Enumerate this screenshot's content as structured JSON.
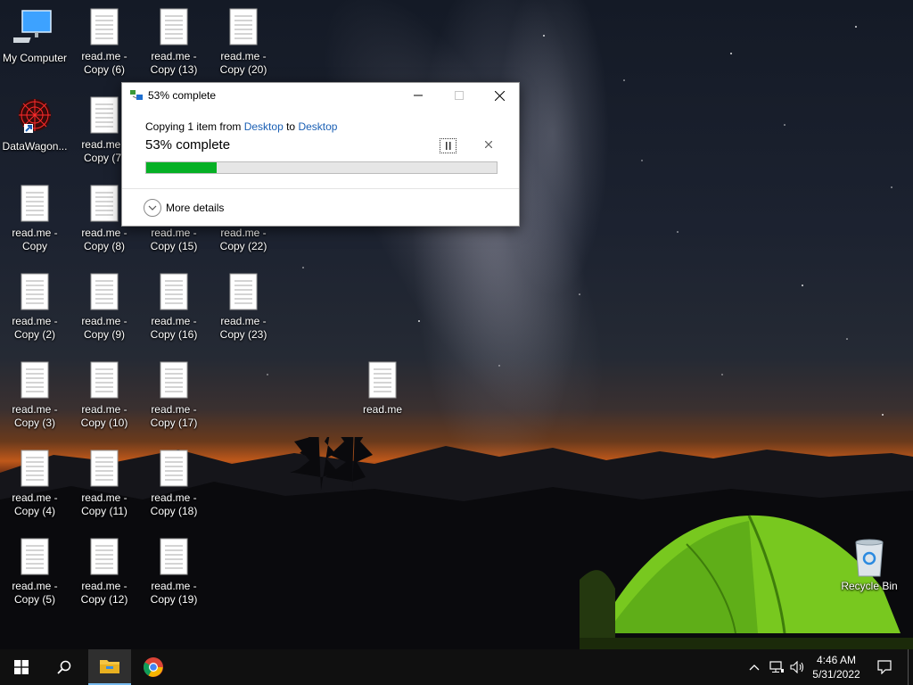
{
  "desktop": {
    "icons": [
      {
        "name": "my-computer",
        "label": "My Computer"
      },
      {
        "name": "datawagon",
        "label": "DataWagon..."
      },
      {
        "name": "read-me-copy",
        "label": "read.me - Copy"
      },
      {
        "name": "read-me-copy-2",
        "label": "read.me - Copy (2)"
      },
      {
        "name": "read-me-copy-3",
        "label": "read.me - Copy (3)"
      },
      {
        "name": "read-me-copy-4",
        "label": "read.me - Copy (4)"
      },
      {
        "name": "read-me-copy-5",
        "label": "read.me - Copy (5)"
      },
      {
        "name": "read-me-copy-6",
        "label": "read.me - Copy (6)"
      },
      {
        "name": "read-me-copy-7",
        "label": "read.me - Copy (7)"
      },
      {
        "name": "read-me-copy-8",
        "label": "read.me - Copy (8)"
      },
      {
        "name": "read-me-copy-9",
        "label": "read.me - Copy (9)"
      },
      {
        "name": "read-me-copy-10",
        "label": "read.me - Copy (10)"
      },
      {
        "name": "read-me-copy-11",
        "label": "read.me - Copy (11)"
      },
      {
        "name": "read-me-copy-12",
        "label": "read.me - Copy (12)"
      },
      {
        "name": "read-me-copy-13",
        "label": "read.me - Copy (13)"
      },
      {
        "name": "read-me-copy-15",
        "label": "read.me - Copy (15)"
      },
      {
        "name": "read-me-copy-16",
        "label": "read.me - Copy (16)"
      },
      {
        "name": "read-me-copy-17",
        "label": "read.me - Copy (17)"
      },
      {
        "name": "read-me-copy-18",
        "label": "read.me - Copy (18)"
      },
      {
        "name": "read-me-copy-19",
        "label": "read.me - Copy (19)"
      },
      {
        "name": "read-me-copy-20",
        "label": "read.me - Copy (20)"
      },
      {
        "name": "read-me-copy-22",
        "label": "read.me - Copy (22)"
      },
      {
        "name": "read-me-copy-23",
        "label": "read.me - Copy (23)"
      },
      {
        "name": "read-me",
        "label": "read.me"
      },
      {
        "name": "recycle-bin",
        "label": "Recycle Bin"
      }
    ]
  },
  "dialog": {
    "title": "53% complete",
    "copy_prefix": "Copying 1 item from ",
    "source": "Desktop",
    "to_word": " to ",
    "destination": "Desktop",
    "heading": "53% complete",
    "progress_fraction": 0.2,
    "progress_color": "#06b025",
    "more_details": "More details"
  },
  "taskbar": {
    "apps": [
      "start",
      "search",
      "file-explorer",
      "chrome"
    ],
    "time": "4:46 AM",
    "date": "5/31/2022"
  },
  "colors": {
    "link": "#1a5fb4",
    "taskbar": "#101010",
    "tent": "#7ed321"
  }
}
